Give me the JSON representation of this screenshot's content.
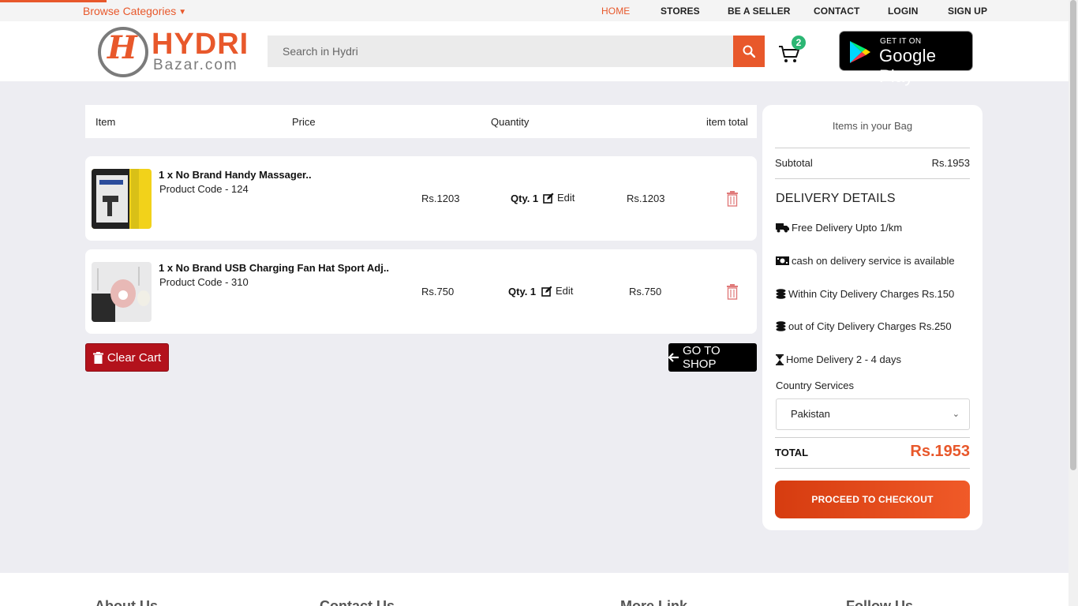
{
  "topbar": {
    "browse_label": "Browse Categories",
    "nav": [
      "HOME",
      "STORES",
      "BE A SELLER",
      "CONTACT",
      "LOGIN",
      "SIGN UP"
    ]
  },
  "header": {
    "logo_top": "HYDRI",
    "logo_bottom": "Bazar.com",
    "logo_mark": "H",
    "search_placeholder": "Search in Hydri",
    "cart_count": "2",
    "gplay_top": "GET IT ON",
    "gplay_main": "Google Play"
  },
  "table": {
    "headers": [
      "Item",
      "Price",
      "Quantity",
      "item total"
    ],
    "rows": [
      {
        "name": "1 x No Brand Handy Massager..",
        "code": "Product Code - 124",
        "price": "Rs.1203",
        "qty": "Qty. 1",
        "edit": "Edit",
        "total": "Rs.1203"
      },
      {
        "name": "1 x No Brand USB Charging Fan Hat Sport Adj..",
        "code": "Product Code - 310",
        "price": "Rs.750",
        "qty": "Qty. 1",
        "edit": "Edit",
        "total": "Rs.750"
      }
    ]
  },
  "actions": {
    "clear_cart": "Clear Cart",
    "go_to_shop": "GO TO SHOP"
  },
  "summary": {
    "title": "Items in your Bag",
    "subtotal_label": "Subtotal",
    "subtotal_value": "Rs.1953",
    "delivery_title": "DELIVERY DETAILS",
    "delivery_items": [
      "Free Delivery Upto 1/km",
      "cash on delivery service is available",
      "Within City Delivery Charges Rs.150",
      "out of City Delivery Charges Rs.250",
      "Home Delivery 2 - 4 days"
    ],
    "country_label": "Country Services",
    "country_value": "Pakistan",
    "total_label": "TOTAL",
    "total_value": "Rs.1953",
    "checkout_label": "PROCEED TO CHECKOUT"
  },
  "footer": {
    "titles": [
      "About Us",
      "Contact Us",
      "More Link",
      "Follow Us"
    ]
  },
  "colors": {
    "brand": "#e8582b",
    "danger": "#b3121c",
    "badge": "#2bb673"
  }
}
